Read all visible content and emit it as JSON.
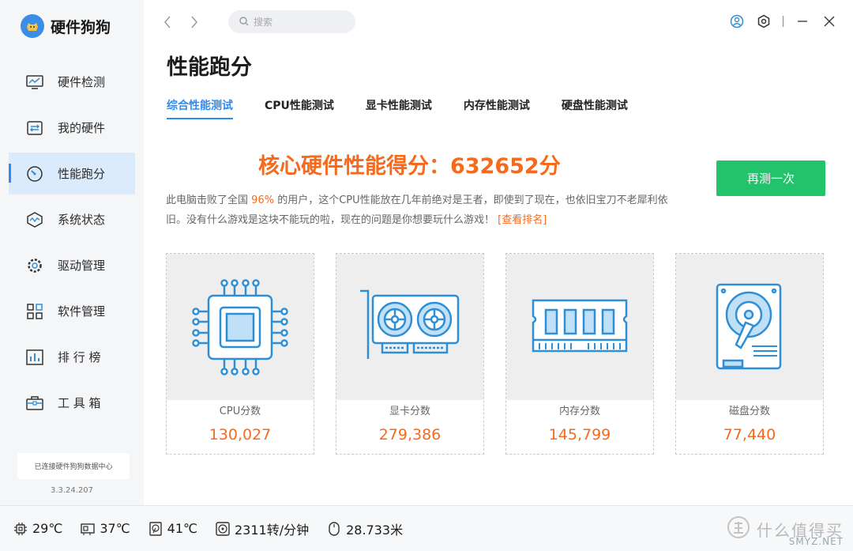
{
  "app": {
    "name": "硬件狗狗",
    "version": "3.3.24.207",
    "status": "已连接硬件狗狗数据中心"
  },
  "sidebar": {
    "items": [
      {
        "label": "硬件检测",
        "icon": "monitor-wave-icon"
      },
      {
        "label": "我的硬件",
        "icon": "hardware-board-icon"
      },
      {
        "label": "性能跑分",
        "icon": "speedometer-icon",
        "active": true
      },
      {
        "label": "系统状态",
        "icon": "system-wave-icon"
      },
      {
        "label": "驱动管理",
        "icon": "gear-icon"
      },
      {
        "label": "软件管理",
        "icon": "apps-grid-icon"
      },
      {
        "label": "排 行 榜",
        "icon": "ranking-chart-icon"
      },
      {
        "label": "工 具 箱",
        "icon": "toolbox-icon"
      }
    ]
  },
  "topbar": {
    "search_placeholder": "搜索"
  },
  "main": {
    "title": "性能跑分",
    "tabs": [
      {
        "label": "综合性能测试",
        "active": true
      },
      {
        "label": "CPU性能测试"
      },
      {
        "label": "显卡性能测试"
      },
      {
        "label": "内存性能测试"
      },
      {
        "label": "硬盘性能测试"
      }
    ],
    "headline": "核心硬件性能得分：632652分",
    "desc_1": "此电脑击败了全国",
    "desc_percent": "96%",
    "desc_2": "的用户，这个CPU性能放在几年前绝对是王者，即使到了现在，也依旧宝刀不老犀利依旧。没有什么游戏是这块不能玩的啦，现在的问题是你想要玩什么游戏！",
    "desc_link": "[查看排名]",
    "retest_label": "再测一次",
    "cards": [
      {
        "label": "CPU分数",
        "score": "130,027",
        "icon": "cpu-chip-icon"
      },
      {
        "label": "显卡分数",
        "score": "279,386",
        "icon": "graphics-card-icon"
      },
      {
        "label": "内存分数",
        "score": "145,799",
        "icon": "memory-module-icon"
      },
      {
        "label": "磁盘分数",
        "score": "77,440",
        "icon": "hard-disk-icon"
      }
    ]
  },
  "bottombar": {
    "cpu_temp": "29℃",
    "gpu_temp": "37℃",
    "disk_temp": "41℃",
    "fan_speed": "2311转/分钟",
    "mouse_distance": "28.733米"
  },
  "watermark": {
    "text": "什么值得买",
    "site": "SMYZ.NET"
  },
  "colors": {
    "accent": "#2d8cf0",
    "score": "#f56a1c",
    "button": "#23c36b",
    "icon": "#2f8fd6"
  }
}
